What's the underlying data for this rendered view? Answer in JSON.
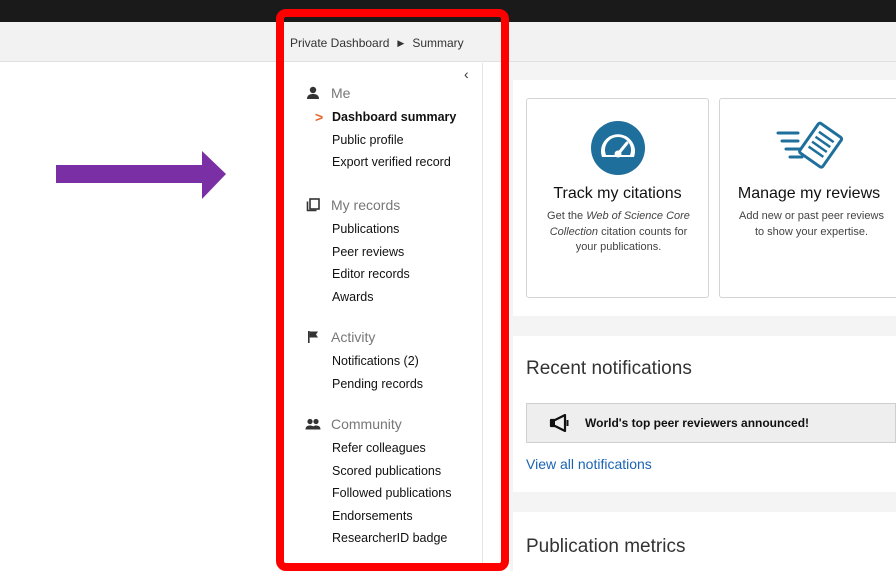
{
  "breadcrumb": {
    "root": "Private Dashboard",
    "current": "Summary"
  },
  "sidebar": {
    "collapse_label": "‹",
    "sections": [
      {
        "title": "Me",
        "icon": "person-icon",
        "items": [
          "Dashboard summary",
          "Public profile",
          "Export verified record"
        ]
      },
      {
        "title": "My records",
        "icon": "records-icon",
        "items": [
          "Publications",
          "Peer reviews",
          "Editor records",
          "Awards"
        ]
      },
      {
        "title": "Activity",
        "icon": "flag-icon",
        "items": [
          "Notifications (2)",
          "Pending records"
        ]
      },
      {
        "title": "Community",
        "icon": "people-icon",
        "items": [
          "Refer colleagues",
          "Scored publications",
          "Followed publications",
          "Endorsements",
          "ResearcherID badge"
        ]
      }
    ],
    "active_item": "Dashboard summary"
  },
  "cards": [
    {
      "title": "Track my citations",
      "icon": "gauge-icon",
      "desc_prefix": "Get the ",
      "desc_em": "Web of Science Core Collection",
      "desc_suffix": " citation counts for your publications."
    },
    {
      "title": "Manage my reviews",
      "icon": "document-speed-icon",
      "desc": "Add new or past peer reviews to show your expertise."
    }
  ],
  "notifications": {
    "heading": "Recent notifications",
    "item": "World's top peer reviewers announced!",
    "item_icon": "megaphone-icon",
    "view_all": "View all notifications"
  },
  "metrics": {
    "heading": "Publication metrics"
  },
  "colors": {
    "accent": "#e8622c",
    "highlight": "#ff0000",
    "arrow": "#7b2fa5",
    "link": "#1a63b5",
    "icon_blue": "#1f6f9c"
  }
}
